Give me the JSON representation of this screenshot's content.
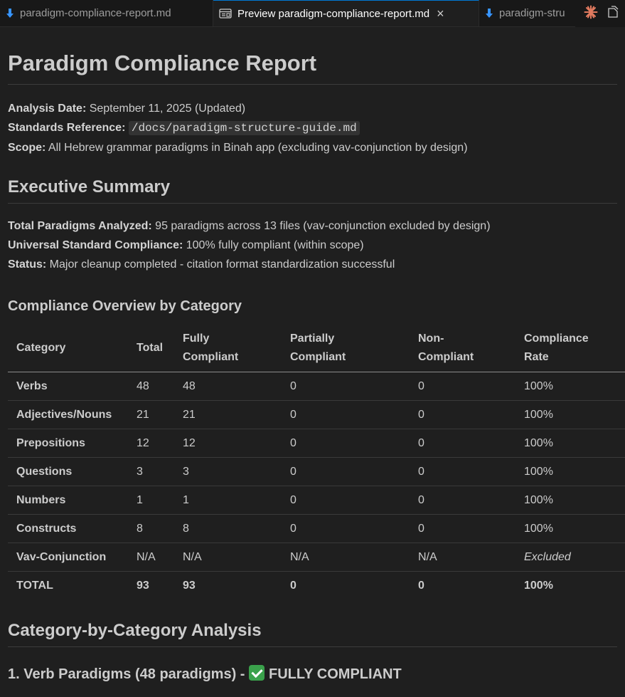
{
  "tabs": [
    {
      "label": "paradigm-compliance-report.md",
      "icon": "download-arrow-icon",
      "active": false
    },
    {
      "label": "Preview paradigm-compliance-report.md",
      "icon": "preview-icon",
      "active": true,
      "close": "×"
    },
    {
      "label": "paradigm-stru",
      "icon": "download-arrow-icon",
      "active": false
    }
  ],
  "colors": {
    "accent": "#0078d4",
    "tab_icon": "#3794ff",
    "claude_icon": "#e07a5f",
    "check": "#3aa14b"
  },
  "doc": {
    "title": "Paradigm Compliance Report",
    "meta": {
      "date_label": "Analysis Date:",
      "date_value": " September 11, 2025 (Updated)",
      "standards_label": "Standards Reference:",
      "standards_value": "/docs/paradigm-structure-guide.md",
      "scope_label": "Scope:",
      "scope_value": " All Hebrew grammar paradigms in Binah app (excluding vav-conjunction by design)"
    },
    "exec_summary": {
      "heading": "Executive Summary",
      "total_label": "Total Paradigms Analyzed:",
      "total_value": " 95 paradigms across 13 files (vav-conjunction excluded by design)",
      "compliance_label": "Universal Standard Compliance:",
      "compliance_value": " 100% fully compliant (within scope)",
      "status_label": "Status:",
      "status_value": " Major cleanup completed - citation format standardization successful"
    },
    "overview": {
      "heading": "Compliance Overview by Category",
      "columns": [
        [
          "Category"
        ],
        [
          "Total"
        ],
        [
          "Fully",
          "Compliant"
        ],
        [
          "Partially",
          "Compliant"
        ],
        [
          "Non-",
          "Compliant"
        ],
        [
          "Compliance",
          "Rate"
        ]
      ],
      "rows": [
        [
          "Verbs",
          "48",
          "48",
          "0",
          "0",
          "100%"
        ],
        [
          "Adjectives/Nouns",
          "21",
          "21",
          "0",
          "0",
          "100%"
        ],
        [
          "Prepositions",
          "12",
          "12",
          "0",
          "0",
          "100%"
        ],
        [
          "Questions",
          "3",
          "3",
          "0",
          "0",
          "100%"
        ],
        [
          "Numbers",
          "1",
          "1",
          "0",
          "0",
          "100%"
        ],
        [
          "Constructs",
          "8",
          "8",
          "0",
          "0",
          "100%"
        ],
        [
          "Vav-Conjunction",
          "N/A",
          "N/A",
          "N/A",
          "N/A",
          "Excluded"
        ],
        [
          "TOTAL",
          "93",
          "93",
          "0",
          "0",
          "100%"
        ]
      ]
    },
    "analysis": {
      "heading": "Category-by-Category Analysis",
      "sub_heading": "1. Verb Paradigms (48 paradigms) - ",
      "sub_status": "FULLY COMPLIANT",
      "check_icon": "green-checkmark-icon"
    }
  }
}
